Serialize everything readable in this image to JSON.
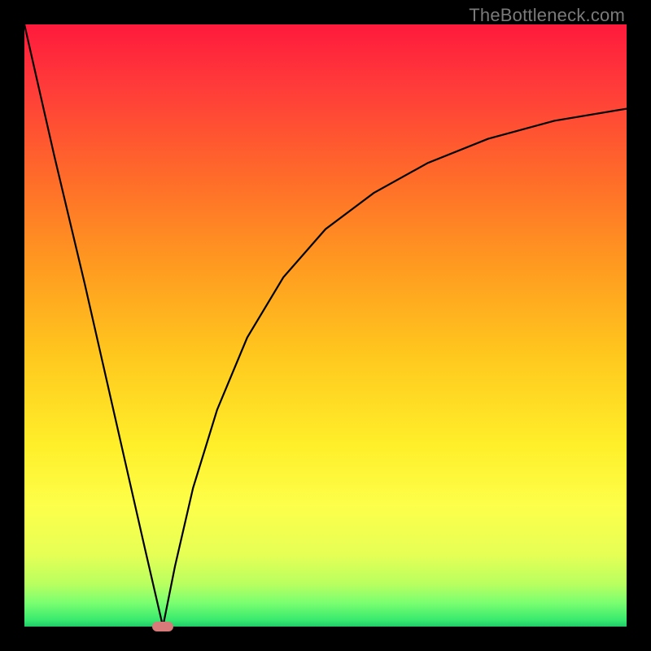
{
  "watermark": "TheBottleneck.com",
  "chart_data": {
    "type": "line",
    "title": "",
    "xlabel": "",
    "ylabel": "",
    "xlim": [
      0,
      100
    ],
    "ylim": [
      0,
      100
    ],
    "background_gradient": {
      "top": "#ff1a3c",
      "bottom": "#1fc96a",
      "meaning": "red-high to green-low"
    },
    "series": [
      {
        "name": "left-descent",
        "x": [
          0,
          5,
          10,
          15,
          20,
          23
        ],
        "values": [
          100,
          78,
          57,
          35,
          13,
          0
        ]
      },
      {
        "name": "right-curve",
        "x": [
          23,
          25,
          28,
          32,
          37,
          43,
          50,
          58,
          67,
          77,
          88,
          100
        ],
        "values": [
          0,
          10,
          23,
          36,
          48,
          58,
          66,
          72,
          77,
          81,
          84,
          86
        ]
      }
    ],
    "marker": {
      "x": 23,
      "y": 0,
      "shape": "rounded-rect",
      "color": "#d87a7a"
    },
    "grid": false,
    "legend": false
  }
}
